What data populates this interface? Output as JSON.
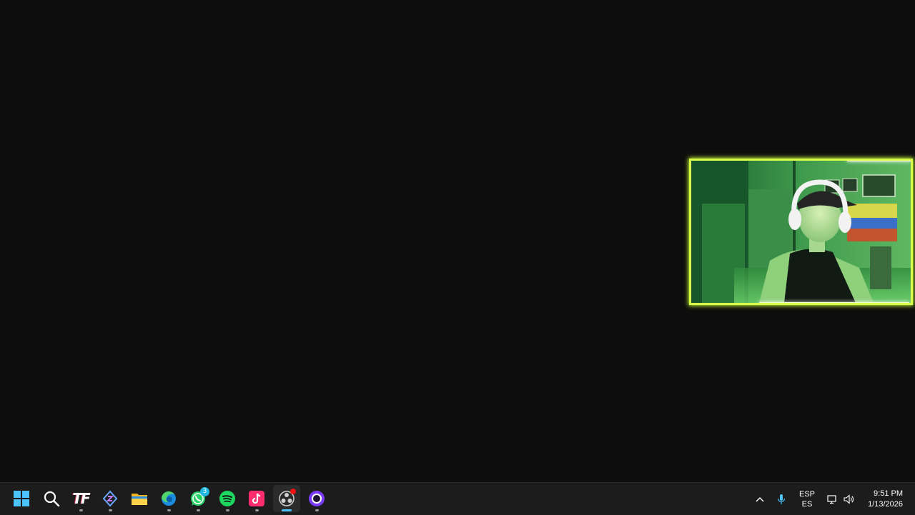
{
  "taskbar": {
    "apps": [
      {
        "name": "start",
        "icon": "windows-logo-icon"
      },
      {
        "name": "search",
        "icon": "search-icon"
      },
      {
        "name": "tf",
        "icon": "tf-app-icon",
        "label": "TF"
      },
      {
        "name": "linear",
        "icon": "linear-app-icon"
      },
      {
        "name": "file-explorer",
        "icon": "folder-icon"
      },
      {
        "name": "edge",
        "icon": "edge-icon"
      },
      {
        "name": "whatsapp",
        "icon": "whatsapp-icon",
        "badge": "3"
      },
      {
        "name": "spotify",
        "icon": "spotify-icon"
      },
      {
        "name": "tiktok",
        "icon": "tiktok-icon"
      },
      {
        "name": "obs",
        "icon": "obs-icon"
      },
      {
        "name": "ring-app",
        "icon": "ring-app-icon"
      }
    ],
    "tray": {
      "language_top": "ESP",
      "language_bottom": "ES",
      "time": "9:51 PM",
      "date": "1/13/2026"
    }
  },
  "colors": {
    "desktop": "#0d0d0d",
    "taskbar": "#1c1c1c",
    "webcam_border": "#d9ff4a",
    "active_indicator": "#4cc2ff"
  }
}
